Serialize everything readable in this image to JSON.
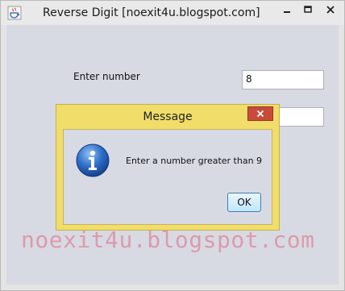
{
  "window": {
    "title": "Reverse Digit [noexit4u.blogspot.com]",
    "app_icon": "java-cup-icon",
    "controls": [
      "minimize-icon",
      "maximize-icon",
      "close-icon"
    ]
  },
  "form": {
    "number_label": "Enter number",
    "number_value": "8",
    "second_value": ""
  },
  "dialog": {
    "title": "Message",
    "message": "Enter a number greater than 9",
    "icon": "info-icon",
    "ok_label": "OK",
    "close_icon": "close-icon"
  },
  "watermark": "noexit4u.blogspot.com",
  "colors": {
    "dialog_frame": "#f0dd6a",
    "panel_bg": "#d8dae3",
    "close_red": "#c94a3b",
    "watermark": "#de8296"
  }
}
